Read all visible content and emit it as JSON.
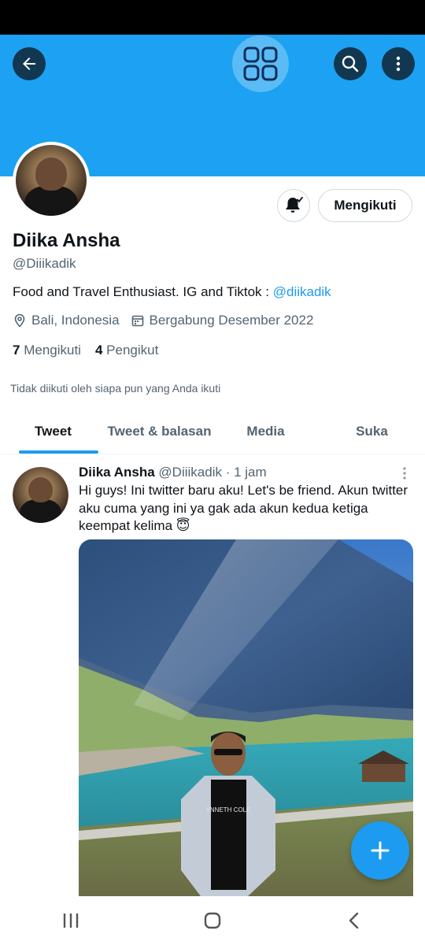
{
  "profile": {
    "name": "Diika Ansha",
    "handle": "@Diiikadik",
    "bio_text": "Food and Travel Enthusiast. IG and Tiktok : ",
    "bio_link": "@diikadik",
    "location": "Bali, Indonesia",
    "joined": "Bergabung Desember 2022",
    "following_count": "7",
    "following_label": "Mengikuti",
    "followers_count": "4",
    "followers_label": "Pengikut",
    "not_followed_note": "Tidak diikuti oleh siapa pun yang Anda ikuti",
    "follow_button_label": "Mengikuti"
  },
  "tabs": [
    {
      "label": "Tweet",
      "active": true
    },
    {
      "label": "Tweet & balasan",
      "active": false
    },
    {
      "label": "Media",
      "active": false
    },
    {
      "label": "Suka",
      "active": false
    }
  ],
  "tweet": {
    "name": "Diika Ansha",
    "meta": "@Diiikadik · 1 jam",
    "text": "Hi guys! Ini twitter baru aku! Let's be friend. Akun twitter aku cuma yang ini ya gak ada akun kedua ketiga keempat kelima 😇",
    "photo_shirt_text": "YNNETH COLE"
  },
  "icons": {
    "back": "back-arrow-icon",
    "apps": "app-grid-icon",
    "search": "search-icon",
    "more": "more-vertical-icon",
    "bell": "notification-bell-icon",
    "location": "location-pin-icon",
    "calendar": "calendar-icon",
    "compose": "plus-icon",
    "nav_recents": "recents-icon",
    "nav_home": "home-icon",
    "nav_back": "nav-back-icon"
  },
  "colors": {
    "banner": "#1da1f2",
    "accent": "#1d9bf0",
    "text_primary": "#0f1419",
    "text_secondary": "#536471"
  }
}
